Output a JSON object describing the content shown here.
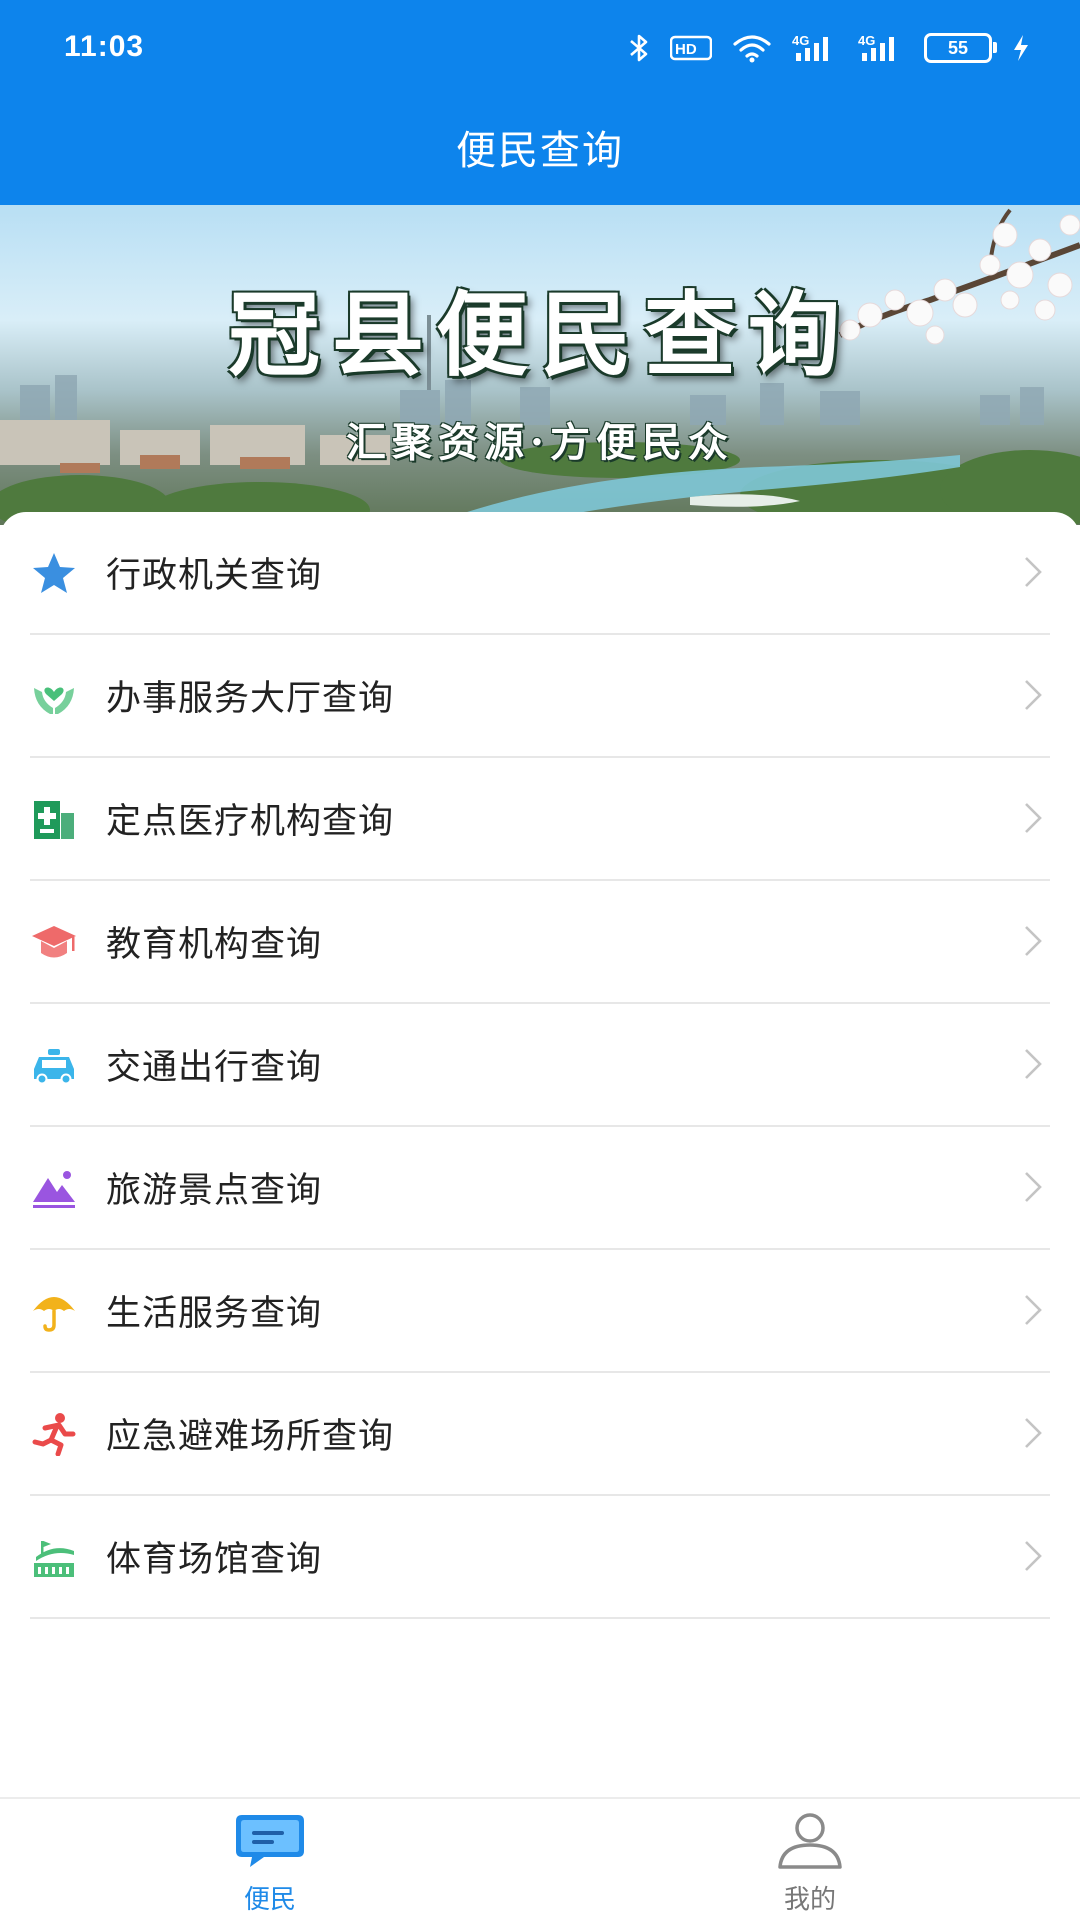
{
  "status_bar": {
    "time": "11:03",
    "hd_label": "HD",
    "signal_1_label": "4G",
    "signal_2_label": "4G",
    "battery_level": "55"
  },
  "header": {
    "title": "便民查询"
  },
  "banner": {
    "title": "冠县便民查询",
    "subtitle": "汇聚资源·方便民众"
  },
  "menu": {
    "items": [
      {
        "label": "行政机关查询",
        "icon": "star-icon",
        "color": "#3a8fe0"
      },
      {
        "label": "办事服务大厅查询",
        "icon": "hands-heart-icon",
        "color": "#49c07a"
      },
      {
        "label": "定点医疗机构查询",
        "icon": "hospital-icon",
        "color": "#1f9a5a"
      },
      {
        "label": "教育机构查询",
        "icon": "graduation-cap-icon",
        "color": "#ee6a6a"
      },
      {
        "label": "交通出行查询",
        "icon": "taxi-icon",
        "color": "#3bb5ea"
      },
      {
        "label": "旅游景点查询",
        "icon": "mountain-icon",
        "color": "#9a55e0"
      },
      {
        "label": "生活服务查询",
        "icon": "umbrella-icon",
        "color": "#f2b21b"
      },
      {
        "label": "应急避难场所查询",
        "icon": "running-person-icon",
        "color": "#ea4a4a"
      },
      {
        "label": "体育场馆查询",
        "icon": "stadium-icon",
        "color": "#4cbf7a"
      }
    ]
  },
  "tabbar": {
    "tabs": [
      {
        "label": "便民",
        "icon": "chat-bubble-icon",
        "active": true,
        "color": "#1f8ae8"
      },
      {
        "label": "我的",
        "icon": "user-icon",
        "active": false,
        "color": "#777777"
      }
    ]
  }
}
